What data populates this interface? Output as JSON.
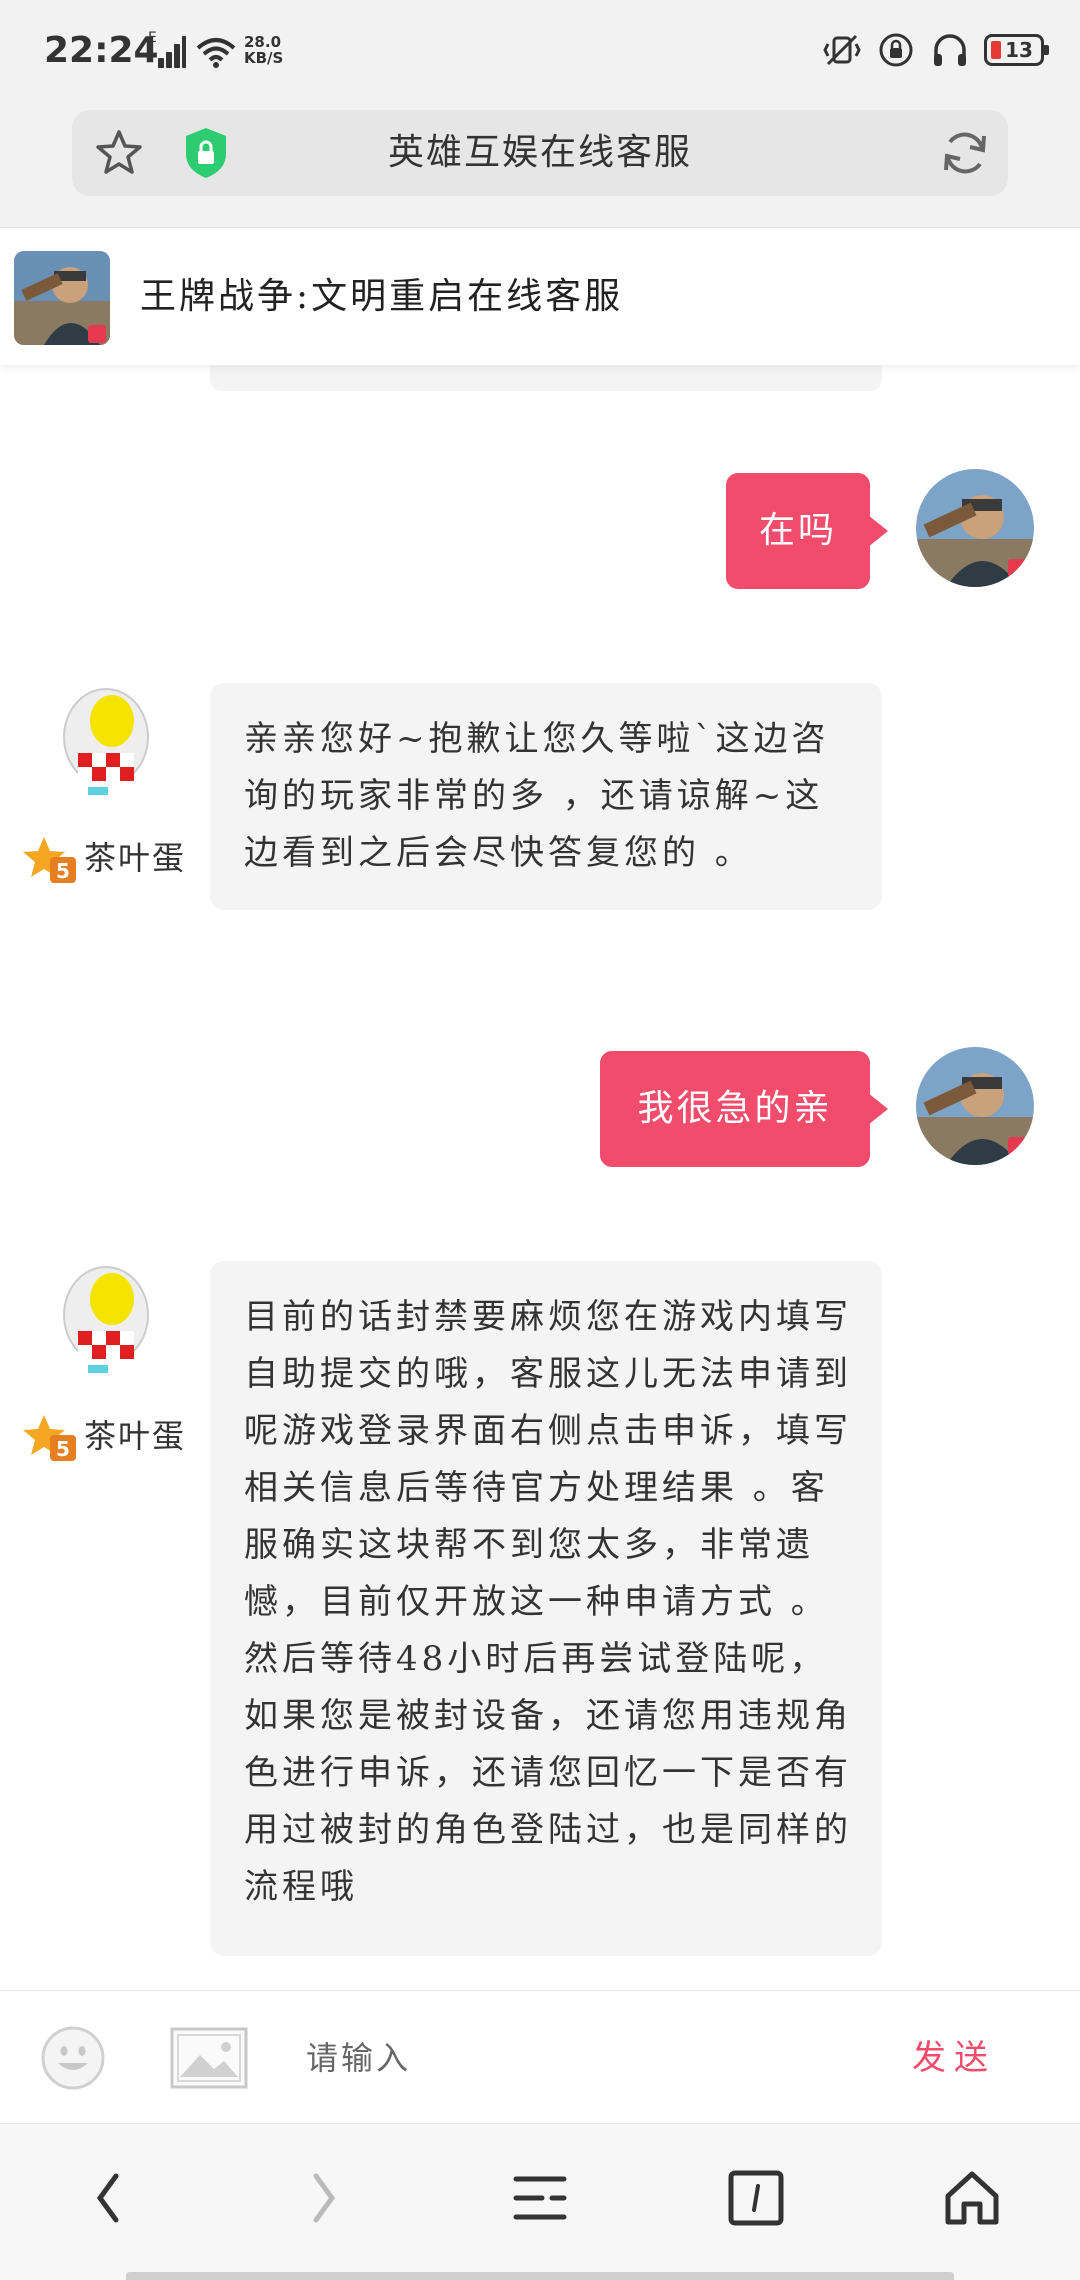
{
  "status_bar": {
    "time": "22:24",
    "network_type": "E",
    "net_speed_value": "28.0",
    "net_speed_unit": "KB/S",
    "battery_level": "13"
  },
  "browser": {
    "page_title": "英雄互娱在线客服"
  },
  "chat_header": {
    "title": "王牌战争:文明重启在线客服"
  },
  "messages": [
    {
      "direction": "out",
      "text": "在吗"
    },
    {
      "direction": "in",
      "sender": "茶叶蛋",
      "badge": "5",
      "text": "亲亲您好~抱歉让您久等啦`这边咨询的玩家非常的多 ，还请谅解~这边看到之后会尽快答复您的 。"
    },
    {
      "direction": "out",
      "text": "我很急的亲"
    },
    {
      "direction": "in",
      "sender": "茶叶蛋",
      "badge": "5",
      "text": "目前的话封禁要麻烦您在游戏内填写自助提交的哦，客服这儿无法申请到呢游戏登录界面右侧点击申诉，填写相关信息后等待官方处理结果 。客服确实这块帮不到您太多，非常遗憾，目前仅开放这一种申请方式 。然后等待48小时后再尝试登陆呢，如果您是被封设备，还请您用违规角色进行申诉，还请您回忆一下是否有用过被封的角色登陆过，也是同样的流程哦"
    }
  ],
  "input_bar": {
    "placeholder": "请输入",
    "send_label": "发送"
  },
  "colors": {
    "accent": "#f24c6c",
    "bubble_in": "#f4f4f4",
    "secure_green": "#2ecc71"
  }
}
